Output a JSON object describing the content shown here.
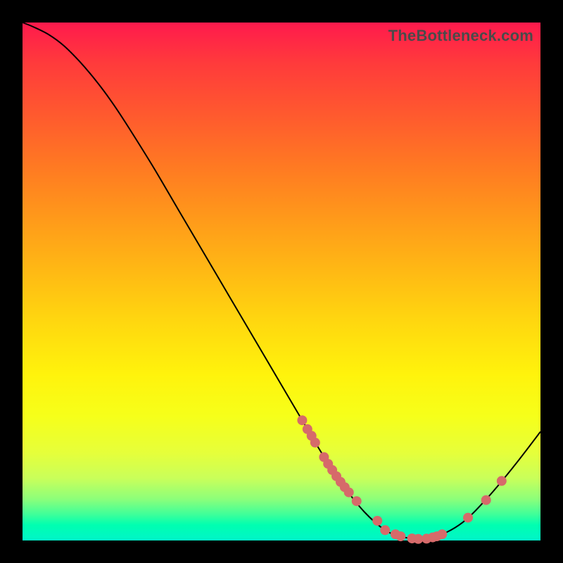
{
  "watermark": "TheBottleneck.com",
  "colors": {
    "point": "#d66a6a",
    "curve": "#000000"
  },
  "chart_data": {
    "type": "line",
    "title": "",
    "xlabel": "",
    "ylabel": "",
    "xlim": [
      0,
      100
    ],
    "ylim": [
      0,
      100
    ],
    "grid": false,
    "series": [
      {
        "name": "bottleneck-curve",
        "x": [
          0,
          2,
          5,
          8,
          11,
          14,
          17,
          20,
          25,
          30,
          35,
          40,
          45,
          50,
          55,
          58,
          62,
          66,
          70,
          73,
          76,
          80,
          85,
          90,
          95,
          100
        ],
        "y": [
          100,
          99.2,
          97.7,
          95.5,
          92.5,
          89.0,
          85.0,
          80.5,
          72.5,
          64.0,
          55.5,
          47.0,
          38.5,
          30.0,
          21.5,
          16.5,
          10.5,
          5.5,
          2.0,
          0.8,
          0.3,
          0.8,
          3.5,
          8.5,
          14.5,
          21.0
        ]
      }
    ],
    "scatter_points": {
      "name": "dots",
      "x": [
        54,
        55,
        55.8,
        56.5,
        58.2,
        59,
        59.8,
        60.6,
        61.4,
        62.2,
        63,
        64.5,
        68.5,
        70,
        72,
        73,
        75.2,
        76.4,
        78,
        79.2,
        80,
        81,
        86,
        89.5,
        92.5
      ],
      "y": [
        23.2,
        21.5,
        20.2,
        18.9,
        16.1,
        14.8,
        13.6,
        12.4,
        11.3,
        10.3,
        9.3,
        7.6,
        3.8,
        2.0,
        1.2,
        0.8,
        0.4,
        0.3,
        0.35,
        0.6,
        0.8,
        1.2,
        4.4,
        7.8,
        11.5
      ]
    }
  }
}
